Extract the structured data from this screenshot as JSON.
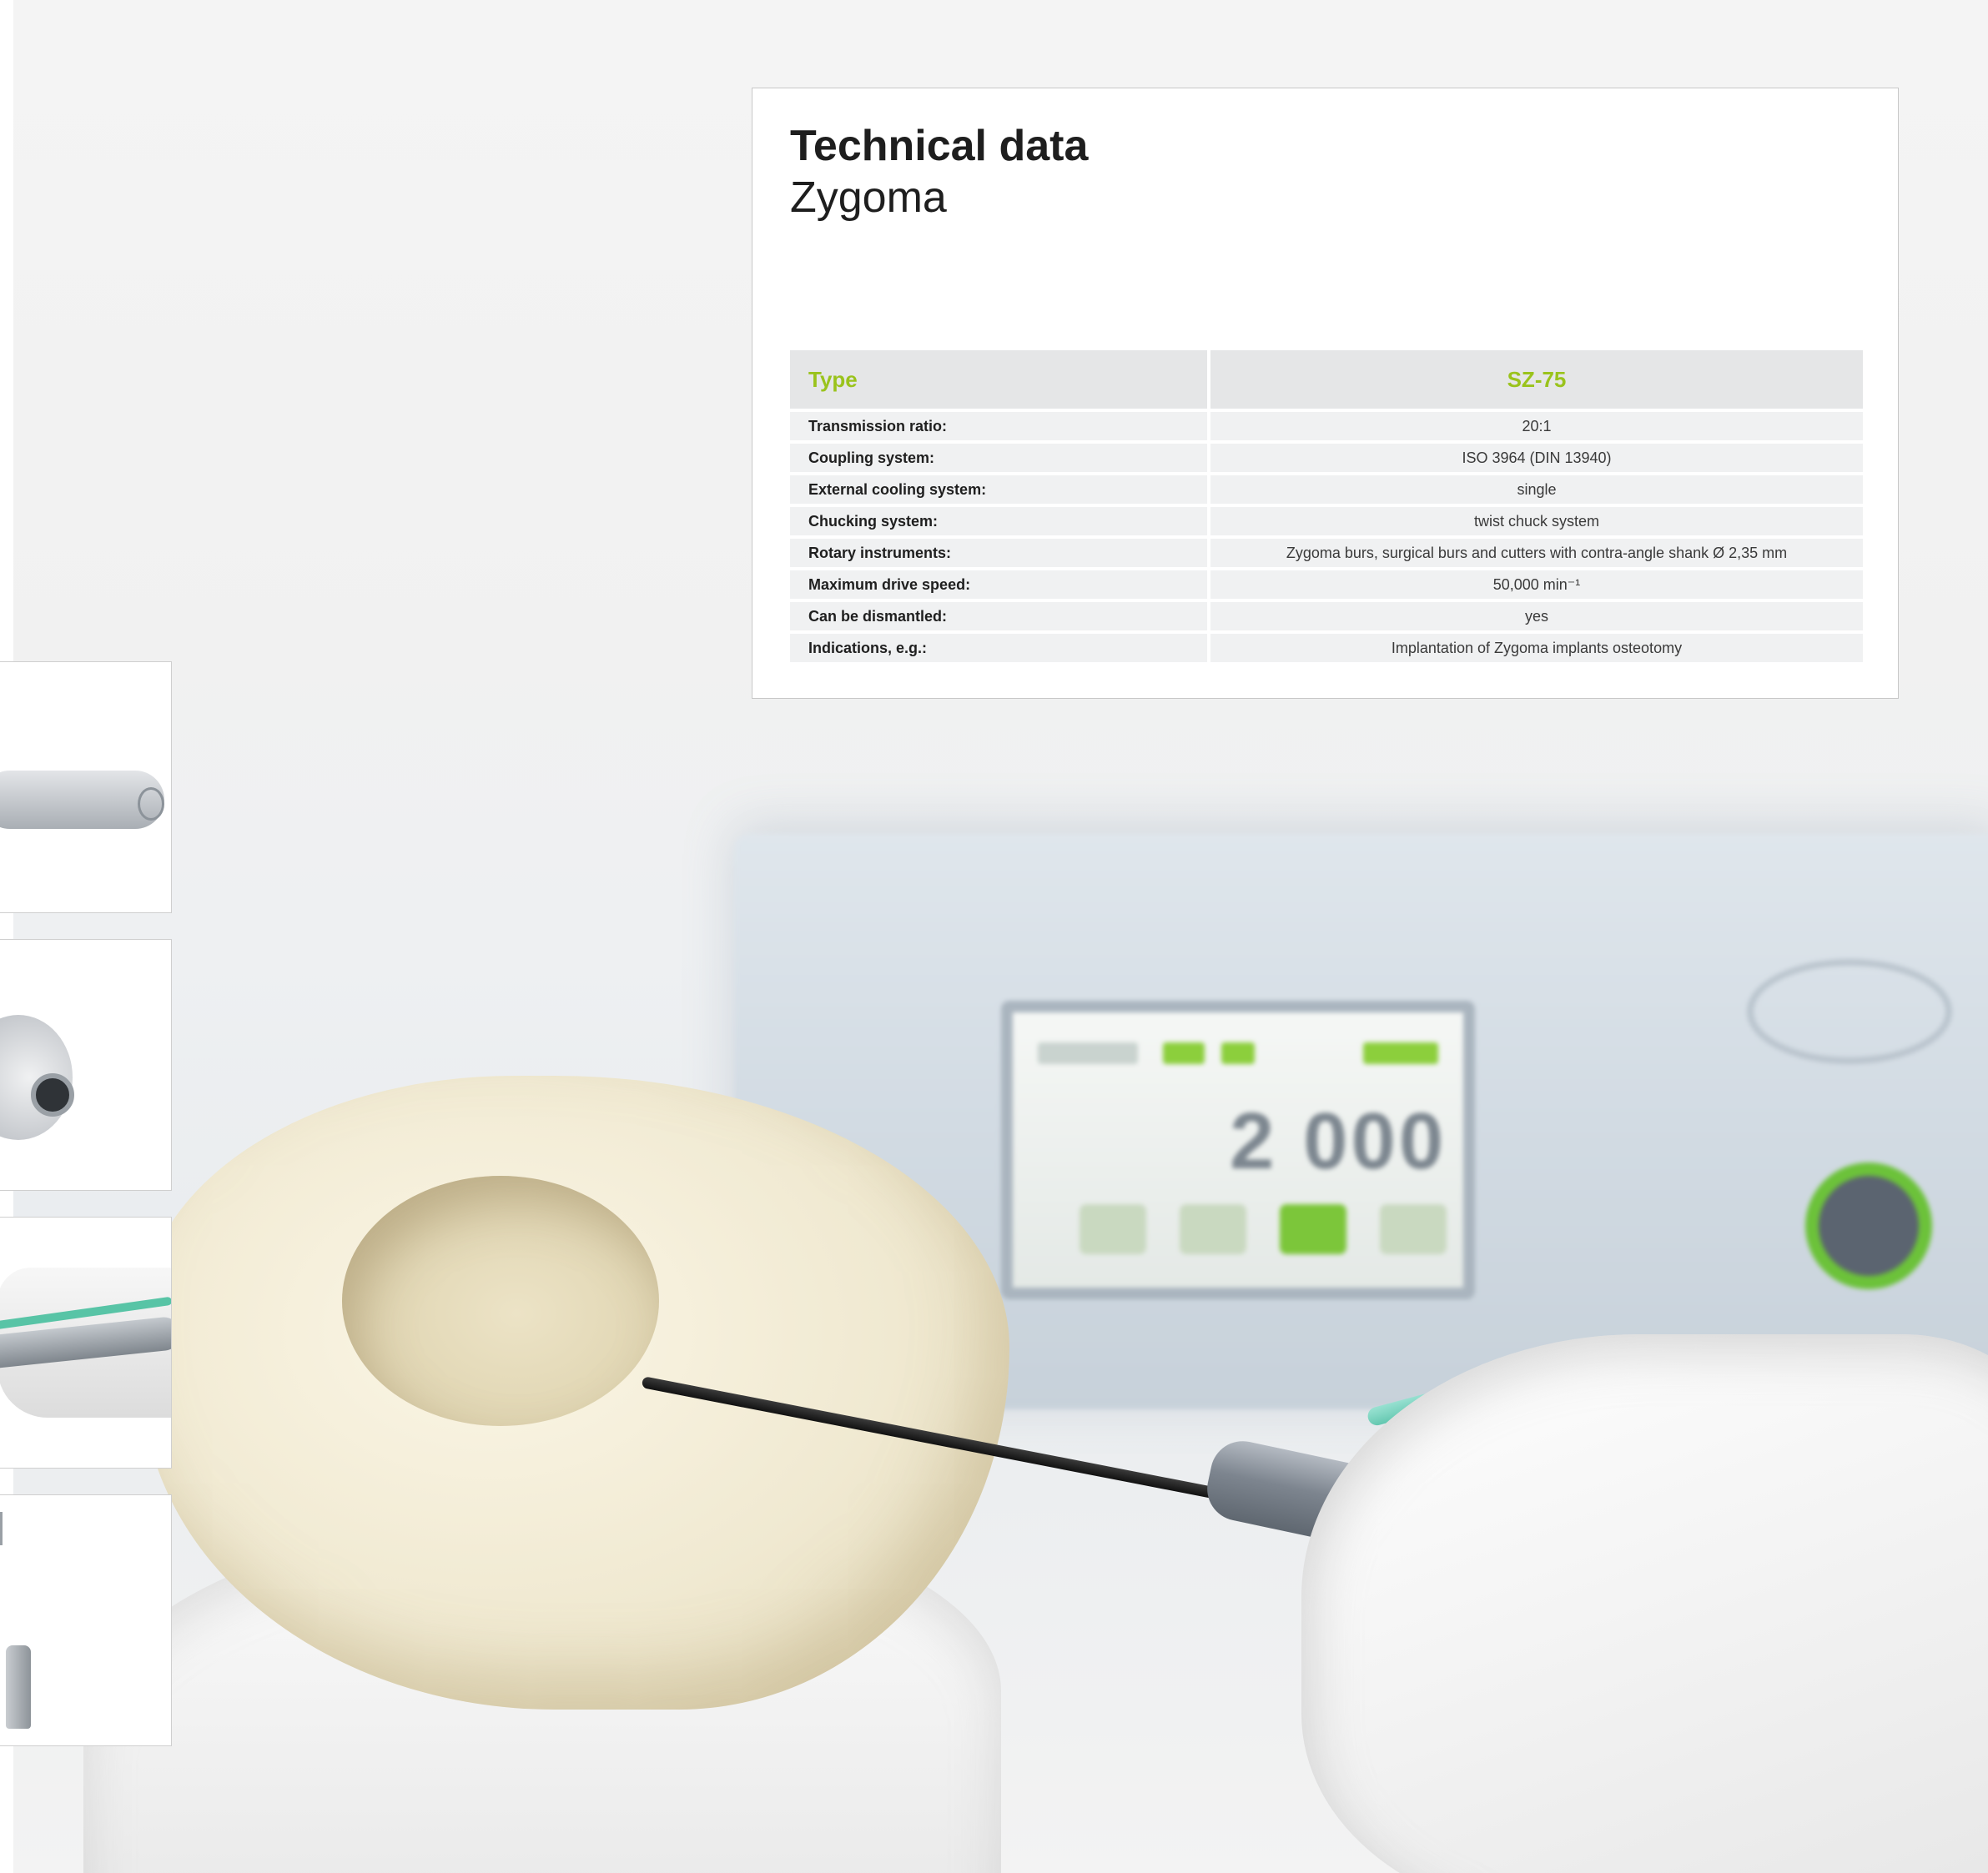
{
  "card": {
    "title": "Technical data",
    "subtitle": "Zygoma"
  },
  "table": {
    "header": {
      "key": "Type",
      "value": "SZ-75"
    },
    "rows": [
      {
        "key": "Transmission ratio:",
        "value": "20:1"
      },
      {
        "key": "Coupling system:",
        "value": "ISO 3964 (DIN 13940)"
      },
      {
        "key": "External cooling system:",
        "value": "single"
      },
      {
        "key": "Chucking system:",
        "value": "twist chuck system"
      },
      {
        "key": "Rotary instruments:",
        "value": "Zygoma burs, surgical burs and cutters with contra-angle shank Ø 2,35 mm"
      },
      {
        "key": "Maximum drive speed:",
        "value": "50,000 min⁻¹"
      },
      {
        "key": "Can be dismantled:",
        "value": "yes"
      },
      {
        "key": "Indications, e.g.:",
        "value": "Implantation of Zygoma implants osteotomy"
      }
    ]
  },
  "device": {
    "readout": "2 000"
  },
  "colors": {
    "accent": "#9ac31c",
    "header_bg": "#e5e6e7",
    "row_bg": "#f0f1f2"
  }
}
